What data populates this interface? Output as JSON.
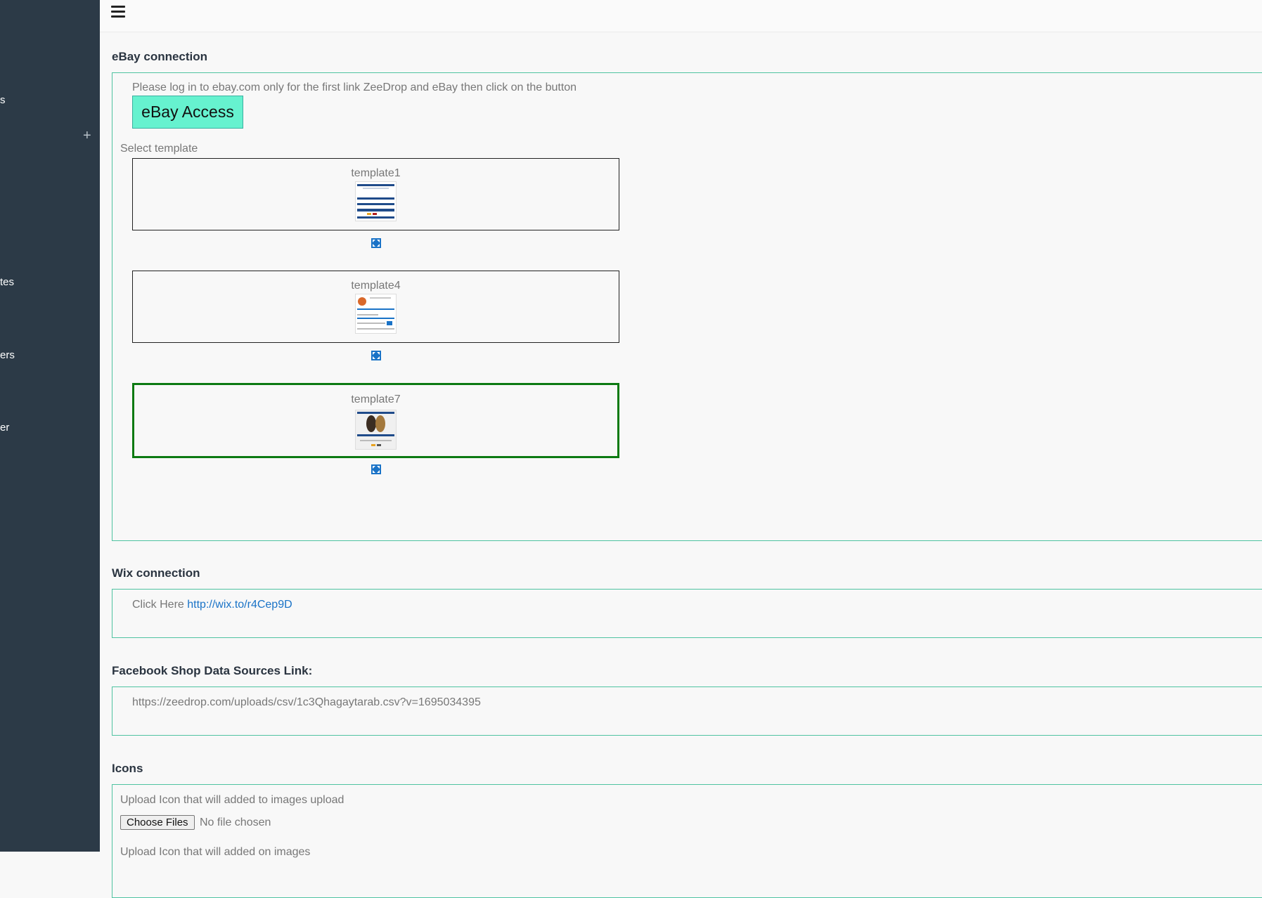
{
  "sidebar": {
    "items": [
      {
        "label": "s"
      },
      {
        "label": "tes"
      },
      {
        "label": "ers"
      },
      {
        "label": "er"
      }
    ],
    "plus_icon": "plus-icon"
  },
  "topbar": {
    "menu_icon": "hamburger-icon"
  },
  "ebay": {
    "title": "eBay connection",
    "instructions": "Please log in to ebay.com only for the first link ZeeDrop and eBay then click on the button",
    "button_label": "eBay Access",
    "select_template_label": "Select template",
    "templates": [
      {
        "name": "template1",
        "selected": false
      },
      {
        "name": "template4",
        "selected": false
      },
      {
        "name": "template7",
        "selected": true
      }
    ],
    "expand_icon": "expand-icon"
  },
  "wix": {
    "title": "Wix connection",
    "prefix": "Click Here",
    "link": "http://wix.to/r4Cep9D"
  },
  "facebook": {
    "title": "Facebook Shop Data Sources Link:",
    "url": "https://zeedrop.com/uploads/csv/1c3Qhagaytarab.csv?v=1695034395"
  },
  "icons": {
    "title": "Icons",
    "upload_label_1": "Upload Icon that will added to images upload",
    "choose_files": "Choose Files",
    "no_file": "No file chosen",
    "upload_label_2": "Upload Icon that will added on images"
  },
  "colors": {
    "sidebar_bg": "#2c3a47",
    "panel_border": "#4fc3a1",
    "button_bg": "#66f2cf",
    "selected_border": "#0c7a12",
    "link": "#1a73c7"
  }
}
